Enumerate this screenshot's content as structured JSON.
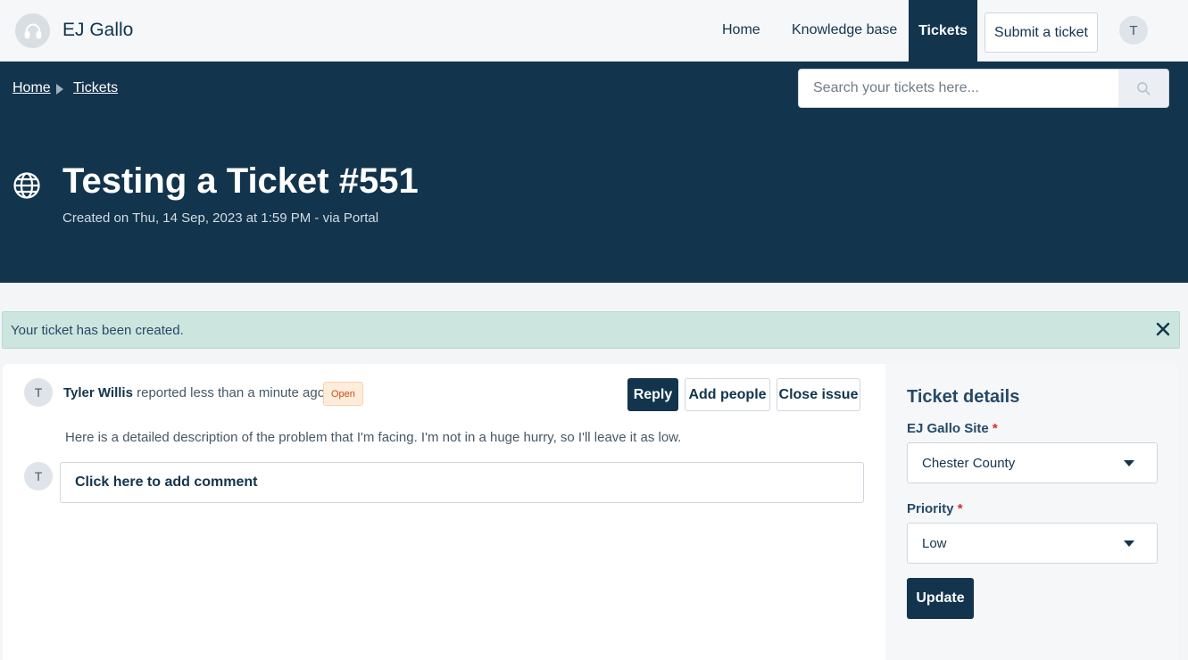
{
  "header": {
    "brand": "EJ Gallo",
    "nav": {
      "home": "Home",
      "knowledge_base": "Knowledge base",
      "tickets": "Tickets",
      "submit_ticket": "Submit a ticket"
    },
    "avatar_initial": "T"
  },
  "breadcrumb": {
    "home": "Home",
    "tickets": "Tickets"
  },
  "search": {
    "placeholder": "Search your tickets here..."
  },
  "ticket": {
    "title": "Testing a Ticket #551",
    "meta": "Created on Thu, 14 Sep, 2023 at 1:59 PM - via Portal",
    "reporter_name": "Tyler Willis",
    "reported_text": " reported less than a minute ago",
    "status": "Open",
    "description": "Here is a detailed description of the problem that I'm facing.  I'm not in a huge hurry, so I'll leave it as low.",
    "comment_placeholder": "Click here to add comment",
    "avatar_initial": "T"
  },
  "alert": {
    "message": "Your ticket has been created."
  },
  "actions": {
    "reply": "Reply",
    "add_people": "Add people",
    "close_issue": "Close issue"
  },
  "details": {
    "title": "Ticket details",
    "site_label": "EJ Gallo Site",
    "site_value": "Chester County",
    "priority_label": "Priority",
    "priority_value": "Low",
    "required_mark": "*",
    "update": "Update"
  },
  "icons": {
    "logo": "headset-icon",
    "search": "search-icon",
    "source": "globe-icon",
    "close": "close-icon",
    "breadcrumb_separator": "caret-right-icon",
    "dropdown": "caret-down-icon"
  },
  "colors": {
    "primary": "#12344d",
    "alert_bg": "#cce5df",
    "badge_bg": "#ffecdb",
    "badge_text": "#c8501a",
    "required": "#d72d30"
  }
}
